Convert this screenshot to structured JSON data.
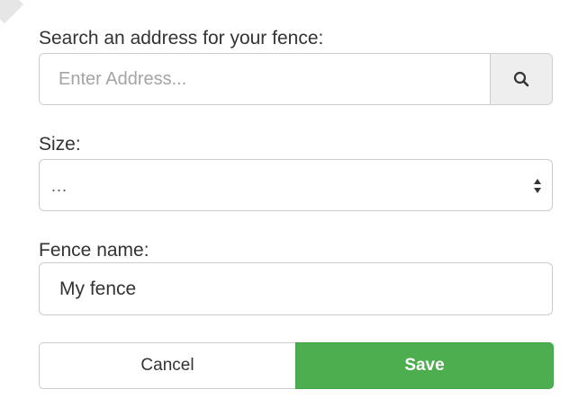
{
  "colors": {
    "accent_save": "#4cae4f",
    "border": "#cccccc",
    "addon_bg": "#eeeeee",
    "text": "#333333",
    "placeholder": "#a4a4a4"
  },
  "search": {
    "label": "Search an address for your fence:",
    "placeholder": "Enter Address...",
    "value": "",
    "button_icon": "search-icon"
  },
  "size": {
    "label": "Size:",
    "selected": "...",
    "icon": "select-arrows-icon"
  },
  "fence_name": {
    "label": "Fence name:",
    "value": "My fence"
  },
  "actions": {
    "cancel_label": "Cancel",
    "save_label": "Save"
  }
}
